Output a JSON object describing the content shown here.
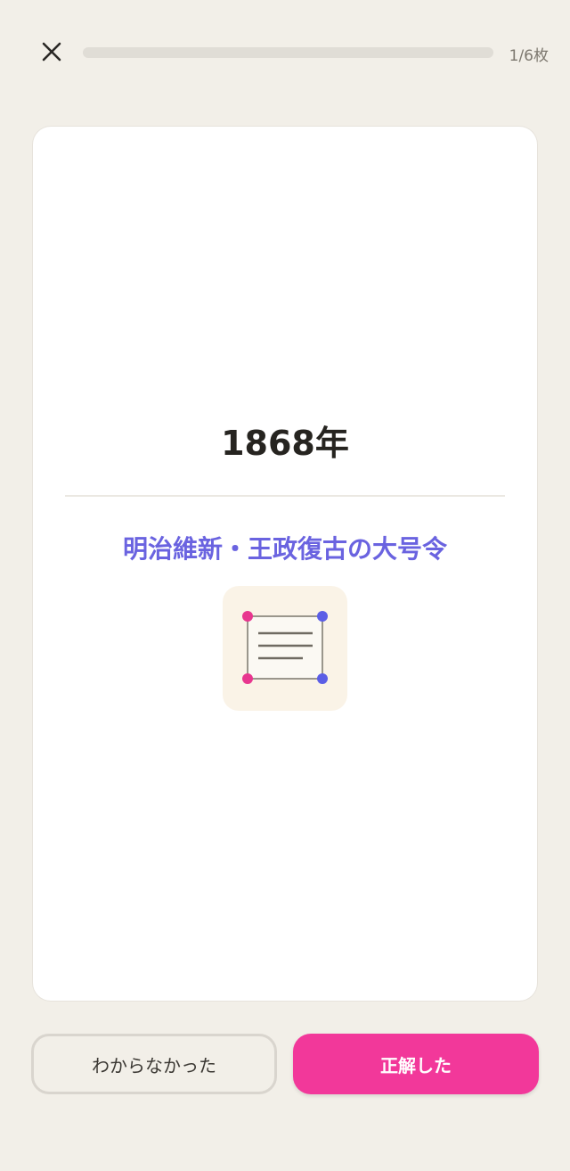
{
  "header": {
    "close_icon": "close-icon",
    "progress": {
      "current": 1,
      "total": 6
    },
    "counter_text": "1/6枚"
  },
  "card": {
    "term": "1868年",
    "meaning": "明治維新・王政復古の大号令",
    "illustration_icon": "document-icon"
  },
  "actions": {
    "unknown_label": "わからなかった",
    "known_label": "正解した"
  },
  "colors": {
    "background": "#f2efe8",
    "accent": "#f2389a",
    "meaning": "#6a63e0",
    "dot_pink": "#e8368f",
    "dot_blue": "#5b5ee6"
  }
}
